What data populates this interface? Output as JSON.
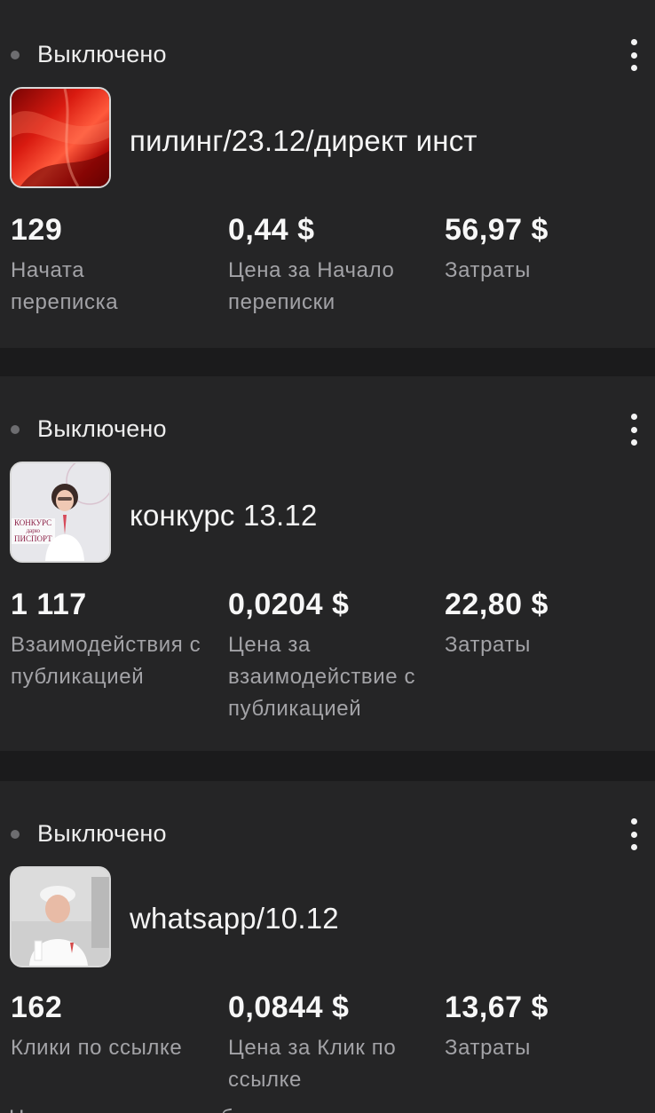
{
  "cards": [
    {
      "status": "Выключено",
      "name": "пилинг/23.12/директ инст",
      "metrics": [
        {
          "value": "129",
          "label": "Начата переписка"
        },
        {
          "value": "0,44 $",
          "label": "Цена за Начало переписки"
        },
        {
          "value": "56,97 $",
          "label": "Затраты"
        }
      ]
    },
    {
      "status": "Выключено",
      "name": "конкурс 13.12",
      "thumbnail_text": [
        "КОНКУРС",
        "дарю",
        "ПИСПОРТ"
      ],
      "metrics": [
        {
          "value": "1 117",
          "label": "Взаимодействия с публикацией"
        },
        {
          "value": "0,0204 $",
          "label": "Цена за взаимодействие с публикацией"
        },
        {
          "value": "22,80 $",
          "label": "Затраты"
        }
      ]
    },
    {
      "status": "Выключено",
      "name": "whatsapp/10.12",
      "metrics": [
        {
          "value": "162",
          "label": "Клики по ссылке"
        },
        {
          "value": "0,0844 $",
          "label": "Цена за Клик по ссылке"
        },
        {
          "value": "13,67 $",
          "label": "Затраты"
        }
      ]
    }
  ],
  "bottom_cut_text": "Начата переписка с бизнесом",
  "icons": {
    "status": "status-dot-icon",
    "more": "more-vertical-icon"
  },
  "colors": {
    "background": "#1b1b1c",
    "card": "#252526",
    "primary_text": "#f5f5f5",
    "secondary_text": "#a3a3a7",
    "status_dot": "#6d6d70"
  }
}
